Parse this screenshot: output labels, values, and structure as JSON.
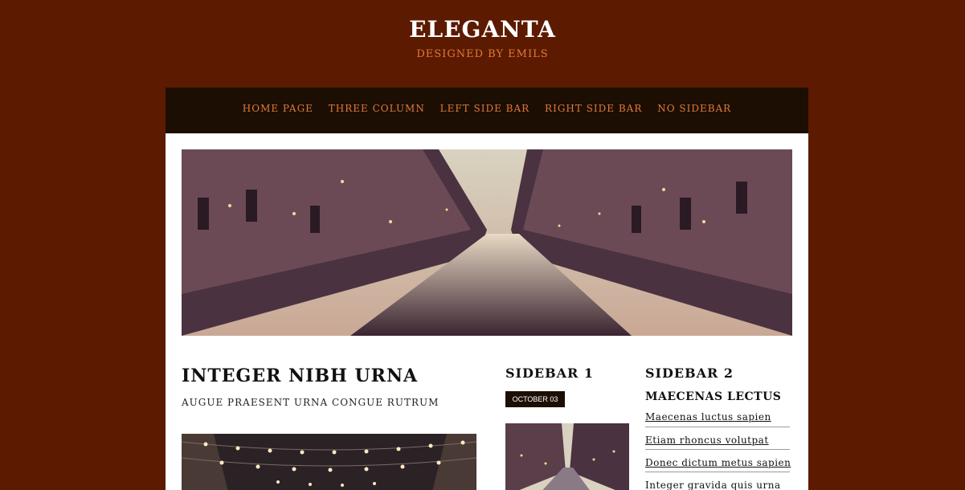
{
  "header": {
    "title": "ELEGANTA",
    "subtitle": "DESIGNED BY EMILS"
  },
  "nav": {
    "items": [
      "HOME PAGE",
      "THREE COLUMN",
      "LEFT SIDE BAR",
      "RIGHT SIDE BAR",
      "NO SIDEBAR"
    ]
  },
  "post": {
    "title": "INTEGER NIBH URNA",
    "subtitle": "AUGUE PRAESENT URNA CONGUE RUTRUM"
  },
  "sidebar1": {
    "title": "SIDEBAR 1",
    "date": "OCTOBER 03"
  },
  "sidebar2": {
    "title": "SIDEBAR 2",
    "subtitle": "MAECENAS LECTUS",
    "links": [
      "Maecenas luctus sapien",
      "Etiam rhoncus volutpat",
      "Donec dictum metus sapien",
      "Integer gravida quis urna"
    ]
  },
  "colors": {
    "background": "#5c1a00",
    "nav_background": "#1c0e03",
    "accent": "#e07a3a"
  }
}
